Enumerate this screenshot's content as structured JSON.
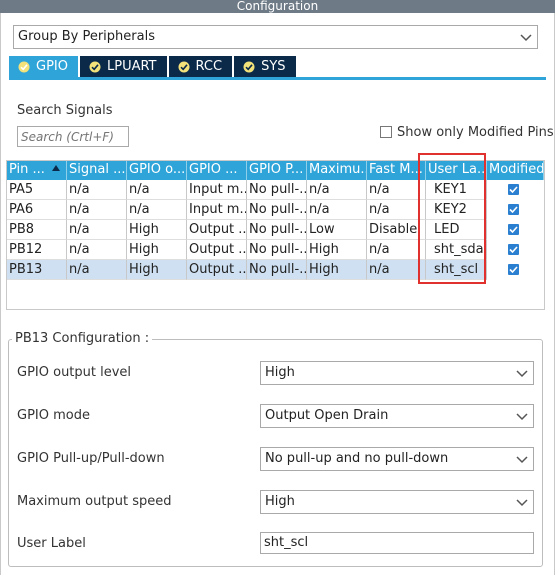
{
  "window": {
    "title": "Configuration"
  },
  "group_by": {
    "value": "Group By Peripherals"
  },
  "tabs": [
    {
      "label": "GPIO",
      "active": true
    },
    {
      "label": "LPUART",
      "active": false
    },
    {
      "label": "RCC",
      "active": false
    },
    {
      "label": "SYS",
      "active": false
    }
  ],
  "search": {
    "label": "Search Signals",
    "placeholder": "Search (Crtl+F)",
    "modified_only_label": "Show only Modified Pins"
  },
  "table": {
    "columns": [
      "Pin ...",
      "Signal ...",
      "GPIO o...",
      "GPIO ...",
      "GPIO P...",
      "Maximu...",
      "Fast M...",
      "User La...",
      "Modified"
    ],
    "rows": [
      {
        "pin": "PA5",
        "signal": "n/a",
        "output_level": "n/a",
        "mode": "Input m...",
        "pull": "No pull-...",
        "speed": "n/a",
        "fast_mode": "n/a",
        "user_label": "KEY1",
        "modified": true,
        "selected": false
      },
      {
        "pin": "PA6",
        "signal": "n/a",
        "output_level": "n/a",
        "mode": "Input m...",
        "pull": "No pull-...",
        "speed": "n/a",
        "fast_mode": "n/a",
        "user_label": "KEY2",
        "modified": true,
        "selected": false
      },
      {
        "pin": "PB8",
        "signal": "n/a",
        "output_level": "High",
        "mode": "Output ...",
        "pull": "No pull-...",
        "speed": "Low",
        "fast_mode": "Disable",
        "user_label": "LED",
        "modified": true,
        "selected": false
      },
      {
        "pin": "PB12",
        "signal": "n/a",
        "output_level": "High",
        "mode": "Output ...",
        "pull": "No pull-...",
        "speed": "High",
        "fast_mode": "n/a",
        "user_label": "sht_sda",
        "modified": true,
        "selected": false
      },
      {
        "pin": "PB13",
        "signal": "n/a",
        "output_level": "High",
        "mode": "Output ...",
        "pull": "No pull-...",
        "speed": "High",
        "fast_mode": "n/a",
        "user_label": "sht_scl",
        "modified": true,
        "selected": true
      }
    ]
  },
  "pin_config": {
    "title": "PB13 Configuration :",
    "fields": [
      {
        "label": "GPIO output level",
        "value": "High"
      },
      {
        "label": "GPIO mode",
        "value": "Output Open Drain"
      },
      {
        "label": "GPIO Pull-up/Pull-down",
        "value": "No pull-up and no pull-down"
      },
      {
        "label": "Maximum output speed",
        "value": "High"
      }
    ],
    "user_label": {
      "label": "User Label",
      "value": "sht_scl"
    }
  },
  "colors": {
    "accent": "#2fa4d8",
    "tab_dark": "#0b2a4a",
    "highlight_box": "#e0312f",
    "selected_row": "#cfe0f2"
  }
}
